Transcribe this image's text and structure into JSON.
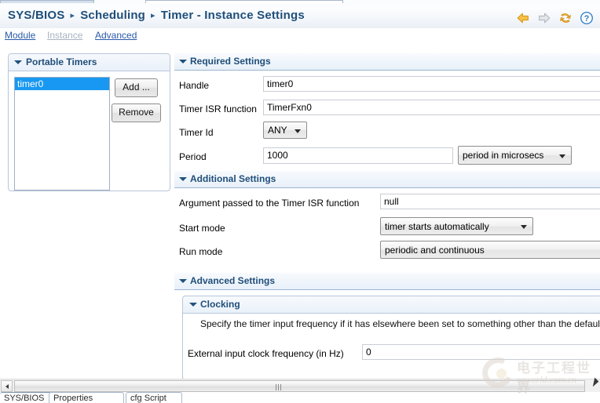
{
  "window": {
    "tab_stubs": [
      "",
      ""
    ]
  },
  "header": {
    "breadcrumb": [
      "SYS/BIOS",
      "Scheduling",
      "Timer - Instance Settings"
    ],
    "separator": "▸",
    "icons": [
      {
        "name": "back-arrow-icon",
        "label": "Back"
      },
      {
        "name": "forward-arrow-icon",
        "label": "Forward"
      },
      {
        "name": "refresh-icon",
        "label": "Refresh"
      },
      {
        "name": "help-icon",
        "label": "Help"
      }
    ]
  },
  "subtabs": [
    {
      "label": "Module",
      "state": "enabled"
    },
    {
      "label": "Instance",
      "state": "disabled"
    },
    {
      "label": "Advanced",
      "state": "enabled"
    }
  ],
  "portable_timers": {
    "title": "Portable Timers",
    "list": [
      {
        "label": "timer0",
        "selected": true
      }
    ],
    "buttons": {
      "add": "Add ...",
      "remove": "Remove"
    }
  },
  "required_settings": {
    "title": "Required Settings",
    "rows": {
      "handle": {
        "label": "Handle",
        "value": "timer0"
      },
      "isr": {
        "label": "Timer ISR function",
        "value": "TimerFxn0"
      },
      "timer_id": {
        "label": "Timer Id",
        "value": "ANY"
      },
      "period": {
        "label": "Period",
        "value": "1000",
        "units": "period in microsecs"
      }
    }
  },
  "additional_settings": {
    "title": "Additional Settings",
    "rows": {
      "argument": {
        "label": "Argument passed to the Timer ISR function",
        "value": "null"
      },
      "start_mode": {
        "label": "Start mode",
        "value": "timer starts automatically"
      },
      "run_mode": {
        "label": "Run mode",
        "value": "periodic and continuous"
      }
    }
  },
  "advanced_settings": {
    "title": "Advanced Settings",
    "clocking": {
      "title": "Clocking",
      "description": "Specify the timer input frequency if it has elsewhere been set to something other than the default.",
      "ext_clock": {
        "label": "External input clock frequency (in Hz)",
        "value": "0"
      }
    }
  },
  "scrollbar": {
    "left_arrow": "◀",
    "grip": "|||"
  },
  "view_tabs": [
    {
      "label": "SYS/BIOS",
      "active": true
    },
    {
      "label": "Properties",
      "active": false
    },
    {
      "label": "cfg Script",
      "active": false
    }
  ],
  "watermark": {
    "cn": "电子工程世界",
    "en": "eeworld.com.cn"
  },
  "colors": {
    "breadcrumb_blue": "#1f4e79",
    "link_blue": "#2a59a8",
    "selection_blue": "#1898f2",
    "panel_border": "#b9c6d8",
    "section_border": "#9bb4d0",
    "icon_orange": "#f0a830",
    "icon_gray": "#c9cdd2",
    "help_blue": "#2f79c0"
  }
}
